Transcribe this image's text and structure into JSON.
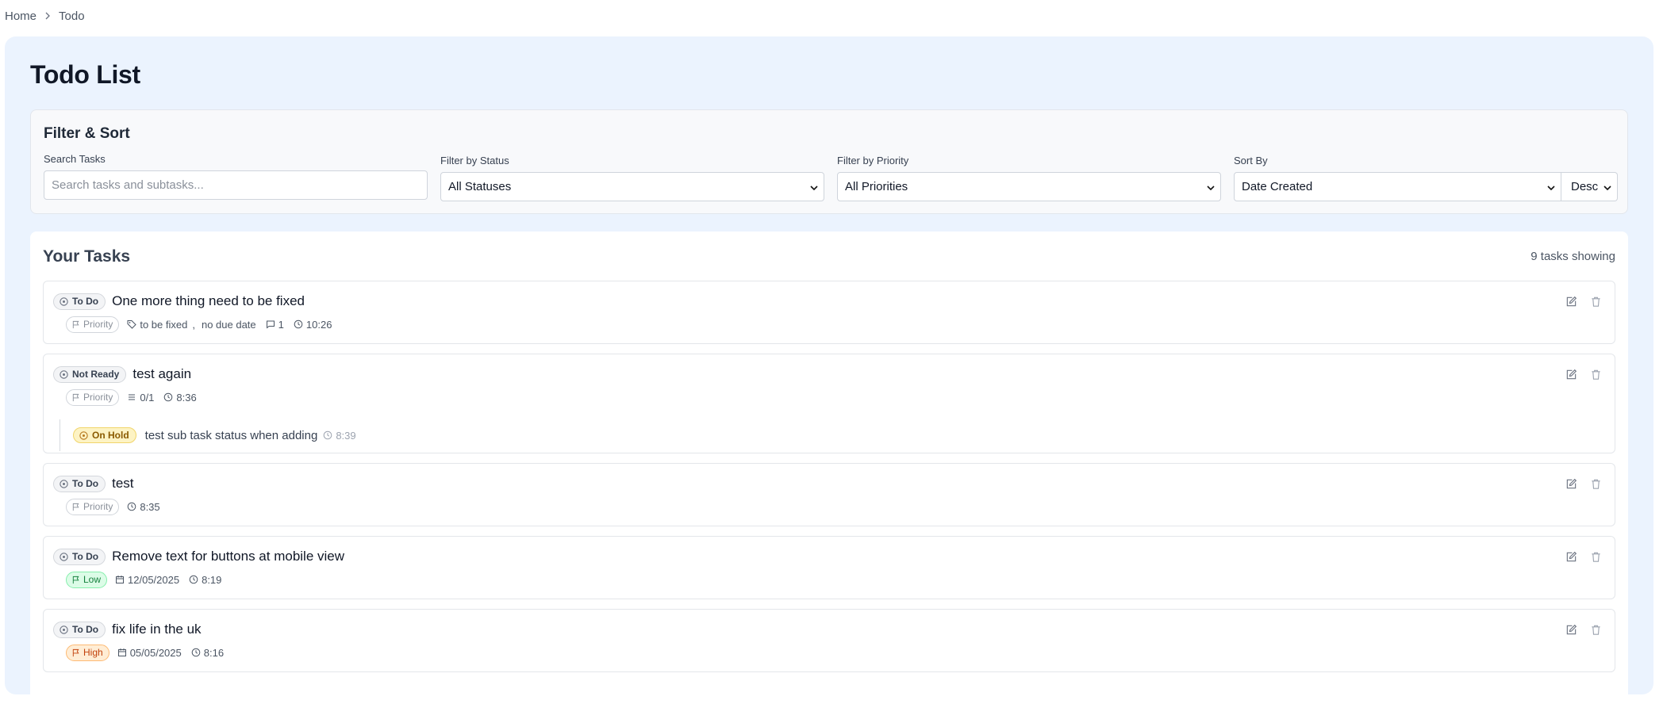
{
  "breadcrumb": {
    "home": "Home",
    "current": "Todo"
  },
  "page": {
    "title": "Todo List"
  },
  "filters": {
    "title": "Filter & Sort",
    "search": {
      "label": "Search Tasks",
      "placeholder": "Search tasks and subtasks..."
    },
    "status": {
      "label": "Filter by Status",
      "value": "All Statuses"
    },
    "priority": {
      "label": "Filter by Priority",
      "value": "All Priorities"
    },
    "sort": {
      "label": "Sort By",
      "value": "Date Created",
      "order": "Desc"
    }
  },
  "tasks": {
    "title": "Your Tasks",
    "count": "9 tasks showing",
    "items": [
      {
        "status": "To Do",
        "title": "One more thing need to be fixed",
        "priority": "Priority",
        "tag": "to be fixed",
        "due": "no due date",
        "comments": "1",
        "time": "10:26"
      },
      {
        "status": "Not Ready",
        "title": "test again",
        "priority": "Priority",
        "subtasks": "0/1",
        "time": "8:36",
        "subtask": {
          "status": "On Hold",
          "title": "test sub task status when adding",
          "time": "8:39"
        }
      },
      {
        "status": "To Do",
        "title": "test",
        "priority": "Priority",
        "time": "8:35"
      },
      {
        "status": "To Do",
        "title": "Remove text for buttons at mobile view",
        "priority": "Low",
        "date": "12/05/2025",
        "time": "8:19"
      },
      {
        "status": "To Do",
        "title": "fix life in the uk",
        "priority": "High",
        "date": "05/05/2025",
        "time": "8:16"
      }
    ]
  },
  "colors": {
    "page_bg": "#ebf3fe",
    "low": "#15803d",
    "high": "#c2410c",
    "hold": "#8a5a00"
  },
  "icons": [
    "chevron-right-icon",
    "chevron-down-icon",
    "circle-status-icon",
    "flag-icon",
    "tag-icon",
    "comment-icon",
    "clock-icon",
    "list-icon",
    "calendar-icon",
    "edit-icon",
    "trash-icon"
  ]
}
